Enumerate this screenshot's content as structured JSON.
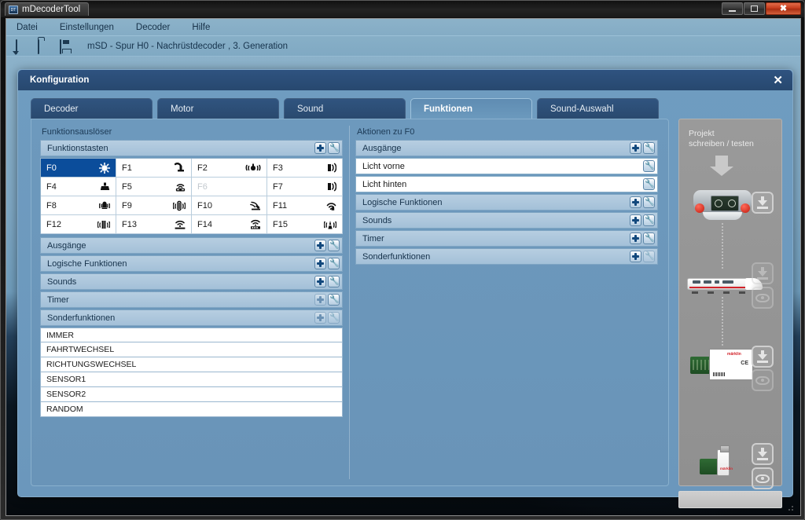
{
  "window": {
    "title": "mDecoderTool",
    "app_icon": "app-icon",
    "controls": {
      "minimize": "minimize",
      "maximize": "maximize",
      "close": "close"
    }
  },
  "menubar": {
    "items": [
      {
        "label": "Datei"
      },
      {
        "label": "Einstellungen"
      },
      {
        "label": "Decoder"
      },
      {
        "label": "Hilfe"
      }
    ]
  },
  "toolbar": {
    "icons": [
      "new-document-icon",
      "open-folder-icon",
      "save-disk-icon"
    ],
    "project_label": "mSD - Spur H0 - Nachrüstdecoder , 3. Generation"
  },
  "dialog": {
    "title": "Konfiguration",
    "close_label": "✕",
    "tabs": [
      {
        "label": "Decoder",
        "active": false
      },
      {
        "label": "Motor",
        "active": false
      },
      {
        "label": "Sound",
        "active": false
      },
      {
        "label": "Funktionen",
        "active": true
      },
      {
        "label": "Sound-Auswahl",
        "active": false
      }
    ]
  },
  "left_column": {
    "caption": "Funktionsauslöser",
    "function_keys_group": {
      "label": "Funktionstasten",
      "add_button": "+",
      "config_button": "wrench"
    },
    "function_keys": [
      {
        "label": "F0",
        "icon": "light-headlight-icon",
        "selected": true,
        "disabled": false
      },
      {
        "label": "F1",
        "icon": "smoke-generator-icon",
        "selected": false,
        "disabled": false
      },
      {
        "label": "F2",
        "icon": "horn-signal-icon",
        "selected": false,
        "disabled": false
      },
      {
        "label": "F3",
        "icon": "whistle-sound-icon",
        "selected": false,
        "disabled": false
      },
      {
        "label": "F4",
        "icon": "telex-coupler-icon",
        "selected": false,
        "disabled": false
      },
      {
        "label": "F5",
        "icon": "sound-antenna-icon",
        "selected": false,
        "disabled": false
      },
      {
        "label": "F6",
        "icon": "none",
        "selected": false,
        "disabled": true
      },
      {
        "label": "F7",
        "icon": "whistle-sound-icon",
        "selected": false,
        "disabled": false
      },
      {
        "label": "F8",
        "icon": "bell-signal-icon",
        "selected": false,
        "disabled": false
      },
      {
        "label": "F9",
        "icon": "compressor-sound-icon",
        "selected": false,
        "disabled": false
      },
      {
        "label": "F10",
        "icon": "shovel-coal-icon",
        "selected": false,
        "disabled": false
      },
      {
        "label": "F11",
        "icon": "hand-signal-icon",
        "selected": false,
        "disabled": false
      },
      {
        "label": "F12",
        "icon": "doors-sound-icon",
        "selected": false,
        "disabled": false
      },
      {
        "label": "F13",
        "icon": "track-sound-icon",
        "selected": false,
        "disabled": false
      },
      {
        "label": "F14",
        "icon": "station-announce-icon",
        "selected": false,
        "disabled": false
      },
      {
        "label": "F15",
        "icon": "signal-tower-icon",
        "selected": false,
        "disabled": false
      }
    ],
    "groups": [
      {
        "label": "Ausgänge",
        "add": true,
        "config": true,
        "add_dim": false,
        "config_dim": false
      },
      {
        "label": "Logische Funktionen",
        "add": true,
        "config": true,
        "add_dim": false,
        "config_dim": false
      },
      {
        "label": "Sounds",
        "add": true,
        "config": true,
        "add_dim": false,
        "config_dim": false
      },
      {
        "label": "Timer",
        "add": true,
        "config": true,
        "add_dim": true,
        "config_dim": false
      },
      {
        "label": "Sonderfunktionen",
        "add": true,
        "config": true,
        "add_dim": true,
        "config_dim": true
      }
    ],
    "special_functions": [
      {
        "label": "IMMER"
      },
      {
        "label": "FAHRTWECHSEL"
      },
      {
        "label": "RICHTUNGSWECHSEL"
      },
      {
        "label": "SENSOR1"
      },
      {
        "label": "SENSOR2"
      },
      {
        "label": "RANDOM"
      }
    ]
  },
  "right_column": {
    "caption": "Aktionen zu F0",
    "rows": [
      {
        "label": "Ausgänge",
        "type": "group",
        "add": true,
        "config": true,
        "add_dim": false,
        "config_dim": false
      },
      {
        "label": "Licht vorne",
        "type": "item",
        "add": false,
        "config": true,
        "add_dim": false,
        "config_dim": false
      },
      {
        "label": "Licht hinten",
        "type": "item",
        "add": false,
        "config": true,
        "add_dim": false,
        "config_dim": false
      },
      {
        "label": "Logische Funktionen",
        "type": "group",
        "add": true,
        "config": true,
        "add_dim": false,
        "config_dim": false
      },
      {
        "label": "Sounds",
        "type": "group",
        "add": true,
        "config": true,
        "add_dim": false,
        "config_dim": false
      },
      {
        "label": "Timer",
        "type": "group",
        "add": true,
        "config": true,
        "add_dim": false,
        "config_dim": false
      },
      {
        "label": "Sonderfunktionen",
        "type": "group",
        "add": true,
        "config": true,
        "add_dim": false,
        "config_dim": true
      }
    ]
  },
  "sidebar": {
    "title": "Projekt\nschreiben / testen",
    "devices": [
      {
        "name": "central-station-device",
        "write_button": "download-icon",
        "write_dim": false,
        "read_button": null,
        "read_dim": false
      },
      {
        "name": "locomotive-device",
        "write_button": "download-icon",
        "write_dim": true,
        "read_button": "preview-icon",
        "read_dim": true
      },
      {
        "name": "decoder-module-device",
        "write_button": "download-icon",
        "write_dim": false,
        "read_button": "preview-icon",
        "read_dim": true
      },
      {
        "name": "usb-programmer-device",
        "write_button": "download-icon",
        "write_dim": false,
        "read_button": "preview-icon",
        "read_dim": false
      }
    ]
  },
  "colors": {
    "accent_selected": "#0b4d9b",
    "dialog_header": "#27486f",
    "panel_bg": "#6d99bd",
    "group_row": "#a3c0d8",
    "sidebar_bg": "#909090",
    "brand_red": "#d2232a"
  }
}
